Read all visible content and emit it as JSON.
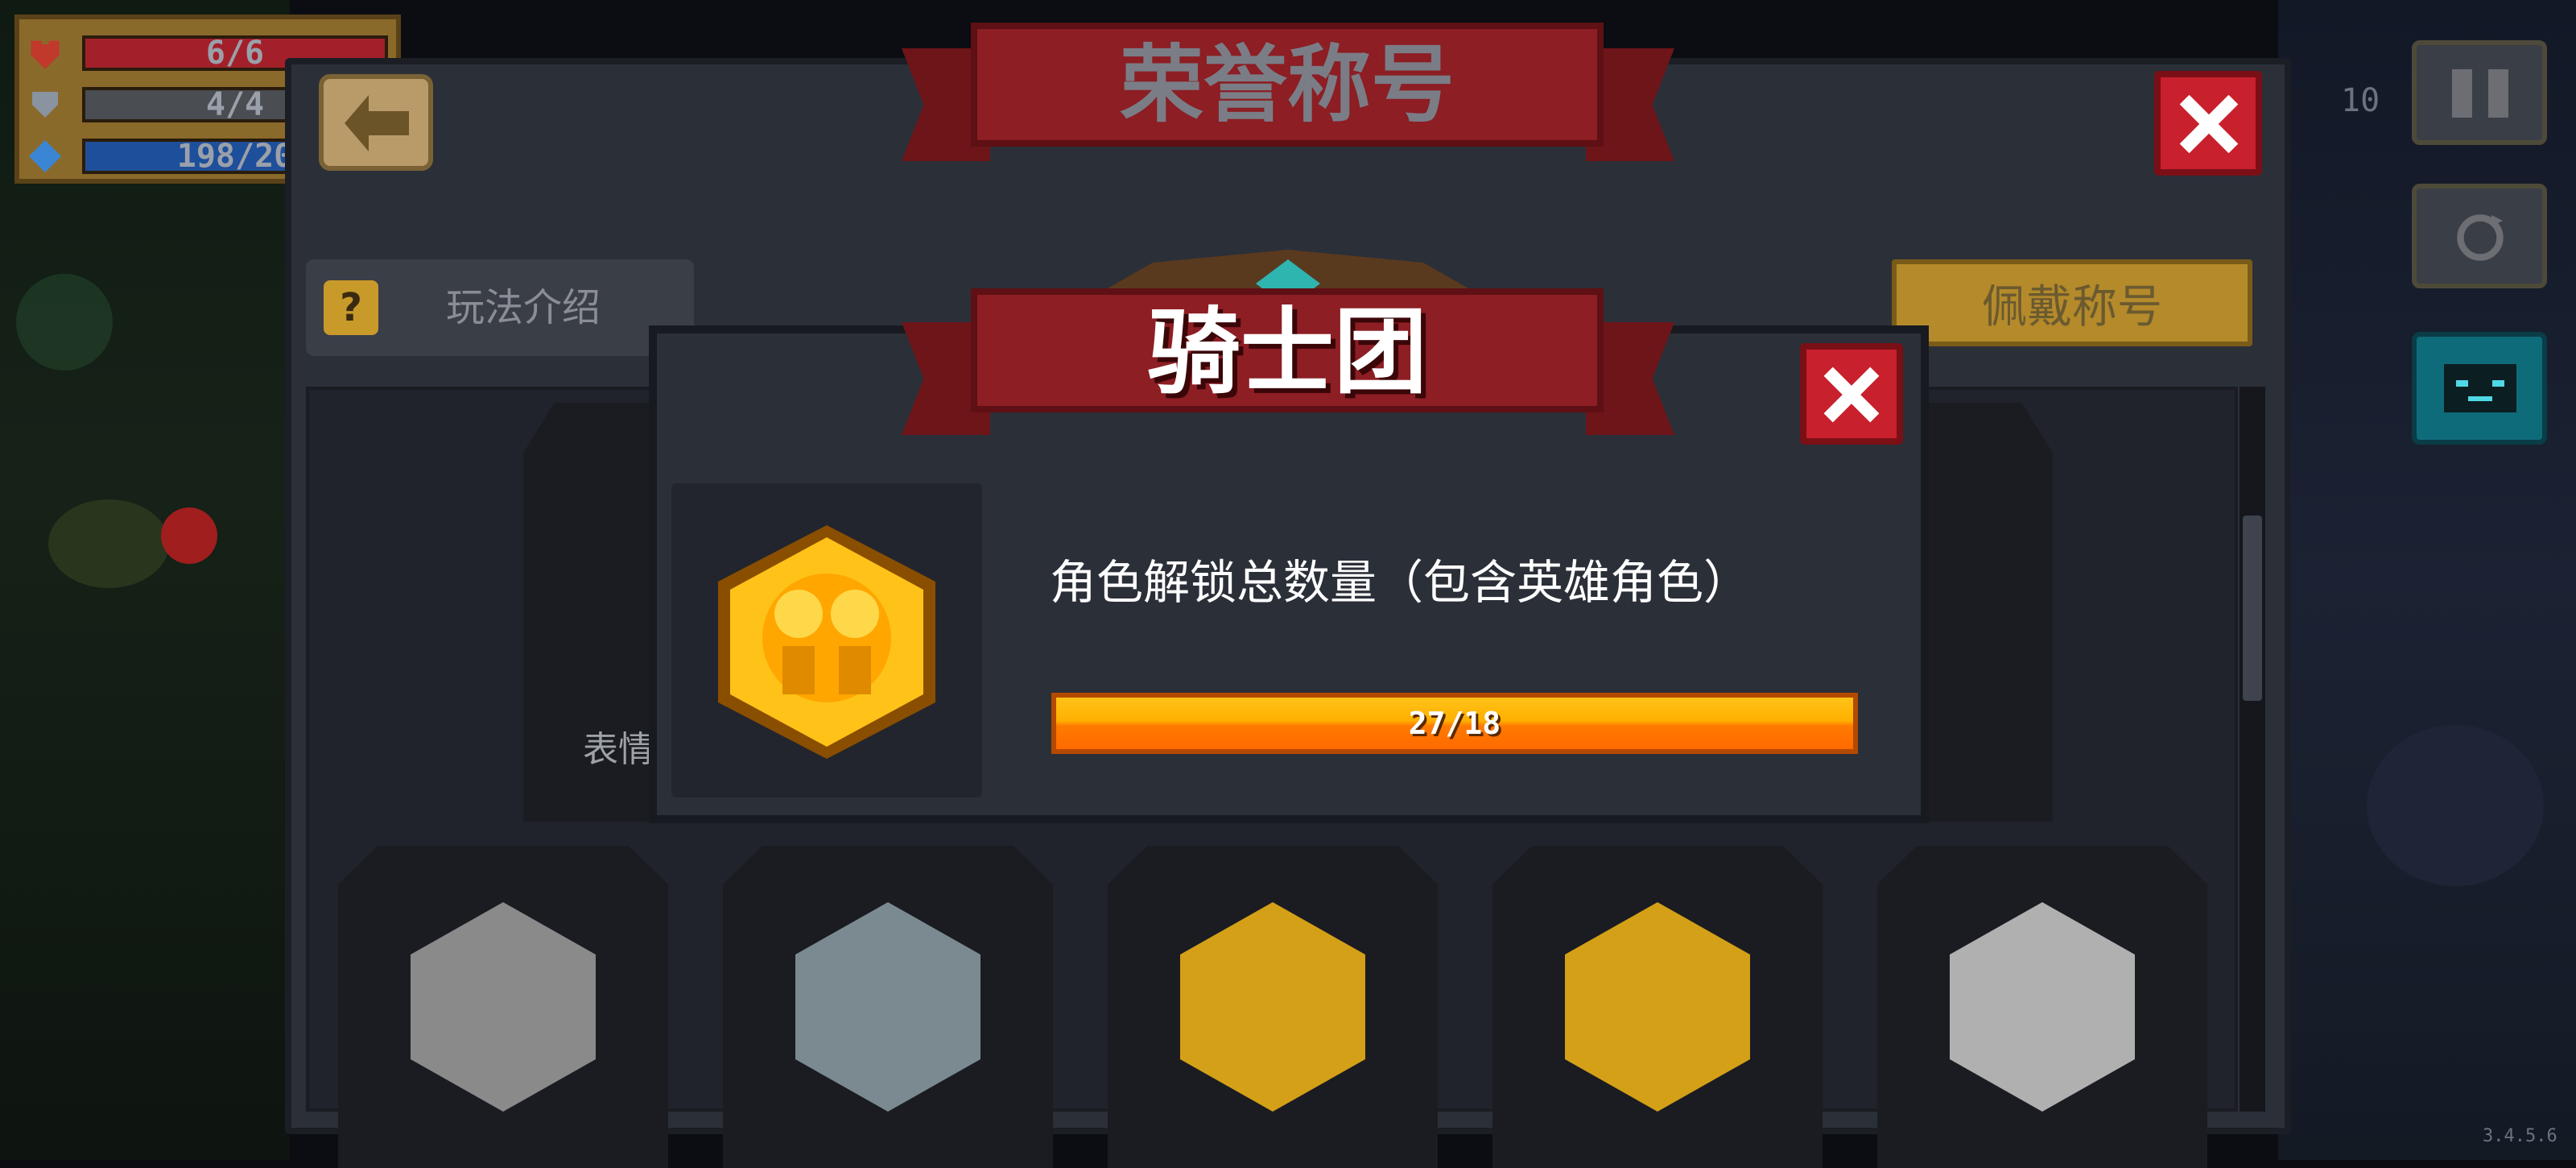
{
  "hud": {
    "health": "6/6",
    "armor": "4/4",
    "energy": "198/20"
  },
  "side": {
    "partial_text": "10",
    "version": "3.4.5.6"
  },
  "main_panel": {
    "title": "荣誉称号",
    "help_label": "玩法介绍",
    "help_icon_glyph": "?",
    "wear_label": "佩戴称号",
    "partial_card_label": "表情"
  },
  "dialog": {
    "title": "骑士团",
    "description": "角色解锁总数量（包含英雄角色）",
    "progress_text": "27/18",
    "progress_fraction": 1.0
  },
  "badges": [
    {
      "name": "badge-1",
      "color": "#8a8a8a"
    },
    {
      "name": "badge-2",
      "color": "#7a8a90"
    },
    {
      "name": "badge-3",
      "color": "#d4a017"
    },
    {
      "name": "badge-4",
      "color": "#d4a017"
    },
    {
      "name": "badge-5",
      "color": "#b0b0b0"
    }
  ],
  "colors": {
    "ribbon": "#8c1e24",
    "close_button": "#c8202c",
    "wear_button": "#b48a2a",
    "progress_orange": "#ff7a00",
    "gold": "#ffc219"
  },
  "icons": [
    "heart-icon",
    "shield-icon",
    "diamond-icon",
    "back-icon",
    "close-icon",
    "help-icon",
    "pause-icon",
    "swap-icon",
    "robot-face-icon",
    "knight-guild-badge-icon"
  ]
}
